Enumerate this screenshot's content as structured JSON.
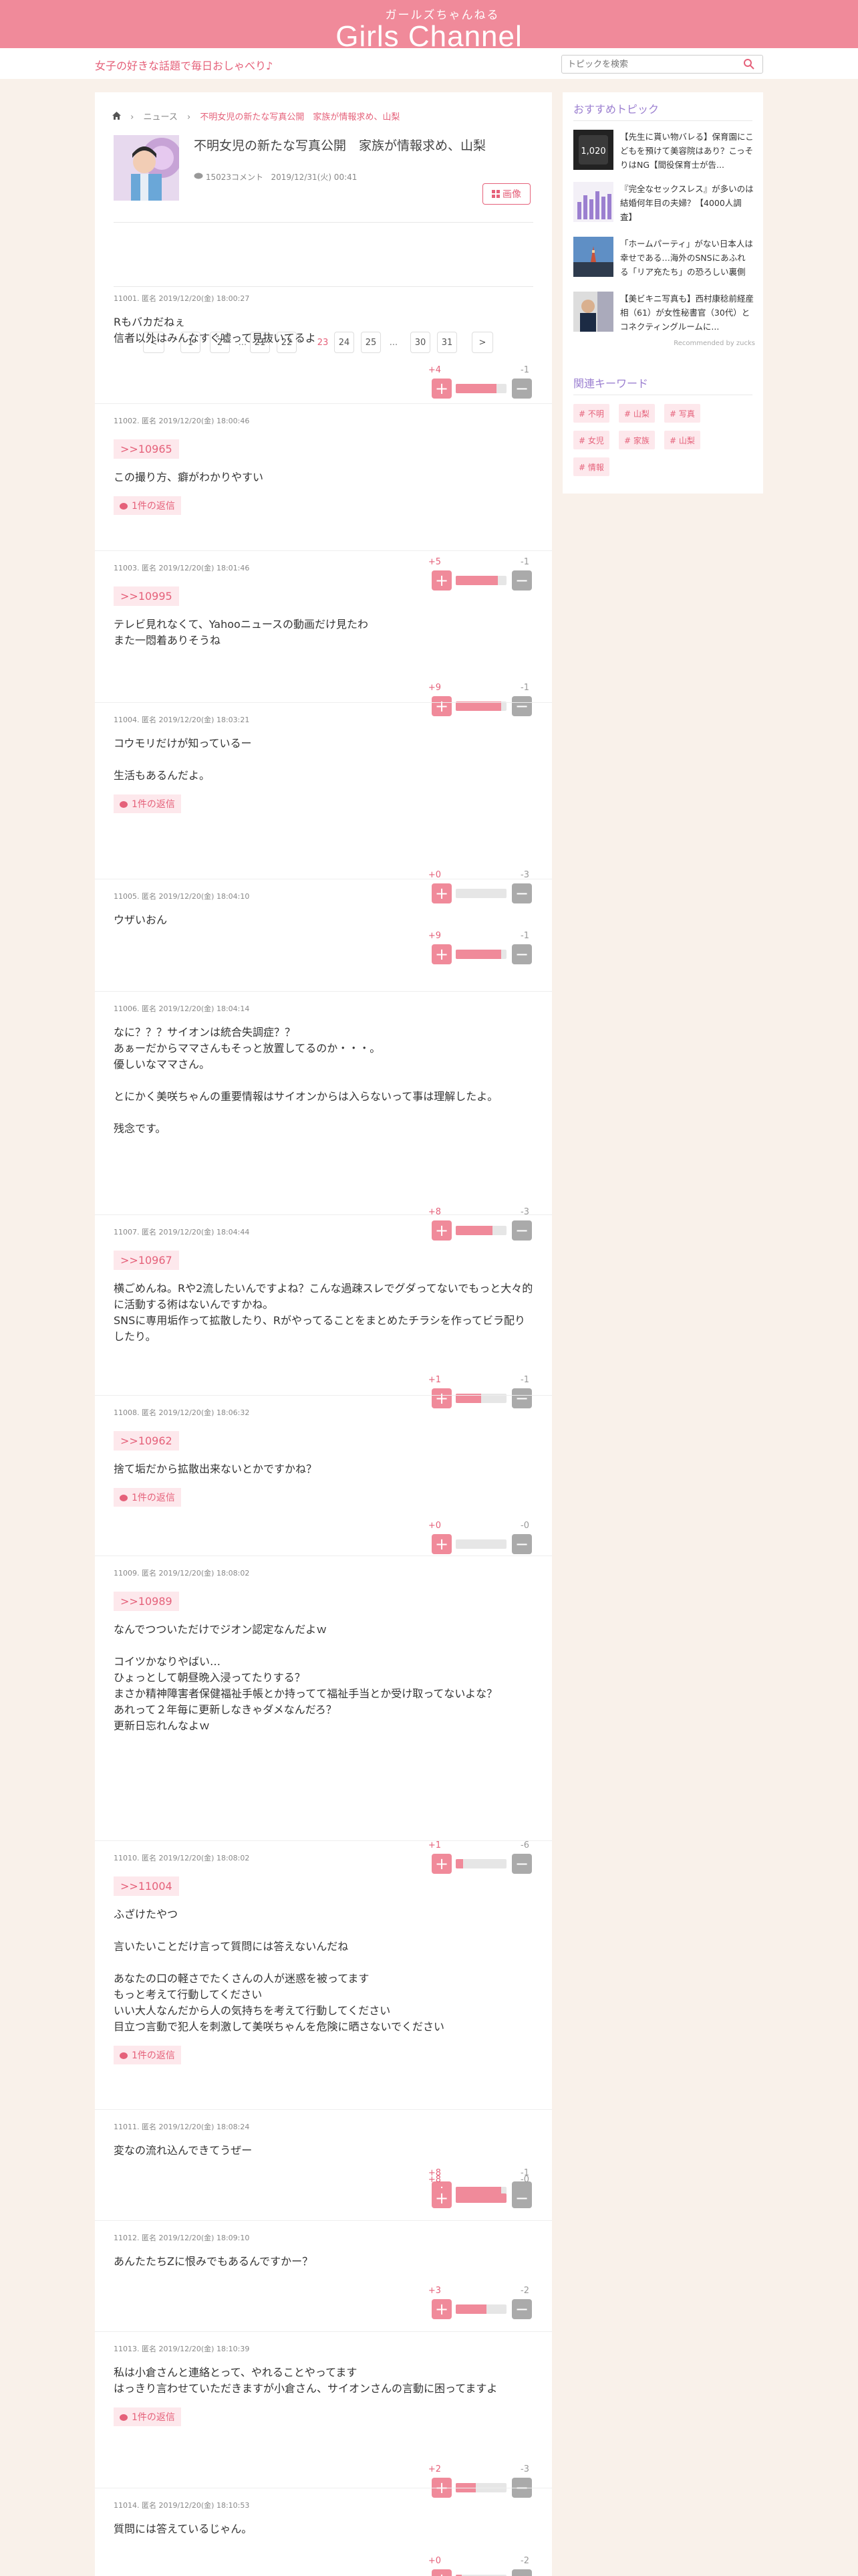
{
  "header": {
    "logo_sub": "ガールズちゃんねる",
    "logo": "Girls Channel",
    "tagline": "女子の好きな話題で毎日おしゃべり♪",
    "search_placeholder": "トピックを検索"
  },
  "breadcrumb": {
    "home": "home",
    "news": "ニュース",
    "current": "不明女児の新たな写真公開　家族が情報求め、山梨"
  },
  "topic": {
    "title": "不明女児の新たな写真公開　家族が情報求め、山梨",
    "comments": "15023コメント",
    "date": "2019/12/31(火) 00:41",
    "image_button": "画像"
  },
  "pager": [
    "<",
    "1",
    "2",
    "...",
    "21",
    "22",
    "23",
    "24",
    "25",
    "...",
    "30",
    "31",
    ">"
  ],
  "comments": [
    {
      "header": "11001. 匿名 2019/12/20(金) 18:00:27",
      "anchor": "",
      "body": "Rもバカだねぇ\n信者以外はみんなすぐ嘘って見抜いてるよ",
      "reply": "",
      "plus": "+4",
      "minus": "-1",
      "ratio": 0.8
    },
    {
      "header": "11002. 匿名 2019/12/20(金) 18:00:46",
      "anchor": ">>10965",
      "body": "この撮り方、癖がわかりやすい",
      "reply": "1件の返信",
      "plus": "+5",
      "minus": "-1",
      "ratio": 0.83
    },
    {
      "header": "11003. 匿名 2019/12/20(金) 18:01:46",
      "anchor": ">>10995",
      "body": "テレビ見れなくて、Yahooニュースの動画だけ見たわ\nまた一悶着ありそうね",
      "reply": "",
      "plus": "+9",
      "minus": "-1",
      "ratio": 0.9
    },
    {
      "header": "11004. 匿名 2019/12/20(金) 18:03:21",
      "anchor": "",
      "body": "コウモリだけが知っているー\n\n生活もあるんだよ。",
      "reply": "1件の返信",
      "plus": "+0",
      "minus": "-3",
      "ratio": 0.0
    },
    {
      "header": "11005. 匿名 2019/12/20(金) 18:04:10",
      "anchor": "",
      "body": "ウザいおん",
      "reply": "",
      "plus": "+9",
      "minus": "-1",
      "ratio": 0.9
    },
    {
      "header": "11006. 匿名 2019/12/20(金) 18:04:14",
      "anchor": "",
      "body": "なに？？？サイオンは統合失調症？？\nあぁーだからママさんもそっと放置してるのか・・・。\n優しいなママさん。\n\nとにかく美咲ちゃんの重要情報はサイオンからは入らないって事は理解したよ。\n\n残念です。",
      "reply": "",
      "plus": "+8",
      "minus": "-3",
      "ratio": 0.73
    },
    {
      "header": "11007. 匿名 2019/12/20(金) 18:04:44",
      "anchor": ">>10967",
      "body": "横ごめんね。Rや2流したいんですよね？こんな過疎スレでグダってないでもっと大々的に活動する術はないんですかね。\nSNSに専用垢作って拡散したり、Rがやってることをまとめたチラシを作ってビラ配りしたり。",
      "reply": "",
      "plus": "+1",
      "minus": "-1",
      "ratio": 0.5
    },
    {
      "header": "11008. 匿名 2019/12/20(金) 18:06:32",
      "anchor": ">>10962",
      "body": "捨て垢だから拡散出来ないとかですかね？",
      "reply": "1件の返信",
      "plus": "+0",
      "minus": "-0",
      "ratio": 0.0
    },
    {
      "header": "11009. 匿名 2019/12/20(金) 18:08:02",
      "anchor": ">>10989",
      "body": "なんでつついただけでジオン認定なんだよｗ\n\nコイツかなりやばい…\nひょっとして朝昼晩入浸ってたりする？\nまさか精神障害者保健福祉手帳とか持ってて福祉手当とか受け取ってないよな？\nあれって２年毎に更新しなきゃダメなんだろ？\n更新日忘れんなよｗ",
      "reply": "",
      "plus": "+1",
      "minus": "-6",
      "ratio": 0.14
    },
    {
      "header": "11010. 匿名 2019/12/20(金) 18:08:02",
      "anchor": ">>11004",
      "body": "ふざけたやつ\n\n言いたいことだけ言って質問には答えないんだね\n\nあなたの口の軽さでたくさんの人が迷惑を被ってます\nもっと考えて行動してください\nいい大人なんだから人の気持ちを考えて行動してください\n目立つ言動で犯人を刺激して美咲ちゃんを危険に晒さないでください",
      "reply": "1件の返信",
      "plus": "+8",
      "minus": "-1",
      "ratio": 0.89
    },
    {
      "header": "11011. 匿名 2019/12/20(金) 18:08:24",
      "anchor": "",
      "body": "変なの流れ込んできてうぜー",
      "reply": "",
      "plus": "+8",
      "minus": "-0",
      "ratio": 1.0
    },
    {
      "header": "11012. 匿名 2019/12/20(金) 18:09:10",
      "anchor": "",
      "body": "あんたたちZに恨みでもあるんですかー？",
      "reply": "",
      "plus": "+3",
      "minus": "-2",
      "ratio": 0.6
    },
    {
      "header": "11013. 匿名 2019/12/20(金) 18:10:39",
      "anchor": "",
      "body": "私は小倉さんと連絡とって、やれることやってます\nはっきり言わせていただきますが小倉さん、サイオンさんの言動に困ってますよ",
      "reply": "1件の返信",
      "plus": "+2",
      "minus": "-3",
      "ratio": 0.4
    },
    {
      "header": "11014. 匿名 2019/12/20(金) 18:10:53",
      "anchor": "",
      "body": "質問には答えているじゃん。",
      "reply": "",
      "plus": "+0",
      "minus": "-2",
      "ratio": 0.12
    }
  ],
  "sidebar": {
    "recommend_title": "おすすめトピック",
    "recommend": [
      {
        "title": "【先生に貰い物バレる】保育園にこどもを預けて美容院はあり？こっそりはNG【間役保育士が告..."
      },
      {
        "title": "『完全なセックスレス』が多いのは結婚何年目の夫婦？【4000人調査】"
      },
      {
        "title": "「ホームパーティ」がない日本人は幸せである…海外のSNSにあふれる「リア充たち」の恐ろしい裏側"
      },
      {
        "title": "【美ビキニ写真も】西村康稔前経産相（61）が女性秘書官（30代）とコネクティングルームに..."
      }
    ],
    "powered": "Recommended by zucks",
    "keywords_title": "関連キーワード",
    "keywords": [
      "# 不明",
      "# 山梨",
      "# 写真",
      "# 女児",
      "# 家族",
      "# 山梨",
      "# 情報"
    ]
  },
  "colors": {
    "accent": "#f08a9a",
    "text_accent": "#e5617a",
    "purple": "#9b7fd0"
  }
}
